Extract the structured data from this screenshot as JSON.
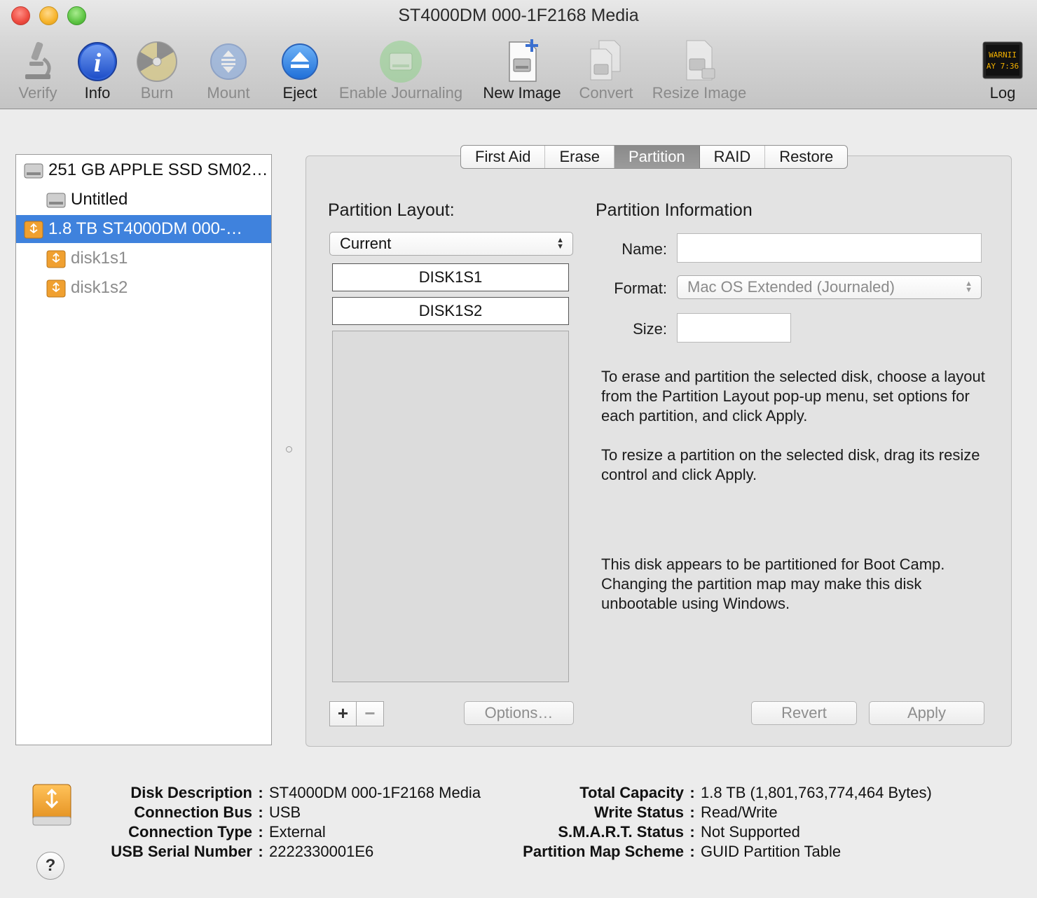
{
  "window": {
    "title": "ST4000DM 000-1F2168 Media"
  },
  "toolbar": {
    "items": [
      {
        "label": "Verify",
        "icon": "microscope-icon",
        "enabled": false
      },
      {
        "label": "Info",
        "icon": "info-icon",
        "enabled": true
      },
      {
        "label": "Burn",
        "icon": "burn-icon",
        "enabled": false
      },
      {
        "label": "Mount",
        "icon": "mount-icon",
        "enabled": false
      },
      {
        "label": "Eject",
        "icon": "eject-icon",
        "enabled": true
      },
      {
        "label": "Enable Journaling",
        "icon": "journaling-icon",
        "enabled": false
      },
      {
        "label": "New Image",
        "icon": "new-image-icon",
        "enabled": true
      },
      {
        "label": "Convert",
        "icon": "convert-icon",
        "enabled": false
      },
      {
        "label": "Resize Image",
        "icon": "resize-image-icon",
        "enabled": false
      },
      {
        "label": "Log",
        "icon": "log-icon",
        "enabled": true
      }
    ],
    "log_icon_text": [
      "WARNII",
      "AY 7:36"
    ]
  },
  "sidebar": {
    "items": [
      {
        "label": "251 GB APPLE SSD SM02…",
        "level": 0,
        "type": "internal-disk"
      },
      {
        "label": "Untitled",
        "level": 1,
        "type": "internal-volume"
      },
      {
        "label": "1.8 TB ST4000DM 000-…",
        "level": 0,
        "type": "usb-disk",
        "selected": true
      },
      {
        "label": "disk1s1",
        "level": 1,
        "type": "usb-volume",
        "dimmed": true
      },
      {
        "label": "disk1s2",
        "level": 1,
        "type": "usb-volume",
        "dimmed": true
      }
    ]
  },
  "tabs": {
    "items": [
      "First Aid",
      "Erase",
      "Partition",
      "RAID",
      "Restore"
    ],
    "active": "Partition"
  },
  "partition": {
    "layout_title": "Partition Layout:",
    "layout_value": "Current",
    "partitions": [
      "DISK1S1",
      "DISK1S2"
    ],
    "info_title": "Partition Information",
    "name_label": "Name:",
    "name_value": "",
    "format_label": "Format:",
    "format_value": "Mac OS Extended (Journaled)",
    "size_label": "Size:",
    "size_value": "",
    "help_text_1": "To erase and partition the selected disk, choose a layout from the Partition Layout pop-up menu, set options for each partition, and click Apply.",
    "help_text_2": "To resize a partition on the selected disk, drag its resize control and click Apply.",
    "help_text_3": "This disk appears to be partitioned for Boot Camp. Changing the partition map may make this disk unbootable using Windows.",
    "add_label": "+",
    "remove_label": "−",
    "options_label": "Options…",
    "revert_label": "Revert",
    "apply_label": "Apply"
  },
  "disk_info": {
    "left": [
      {
        "key": "Disk Description",
        "value": "ST4000DM 000-1F2168 Media"
      },
      {
        "key": "Connection Bus",
        "value": "USB"
      },
      {
        "key": "Connection Type",
        "value": "External"
      },
      {
        "key": "USB Serial Number",
        "value": "2222330001E6"
      }
    ],
    "right": [
      {
        "key": "Total Capacity",
        "value": "1.8 TB (1,801,763,774,464 Bytes)"
      },
      {
        "key": "Write Status",
        "value": "Read/Write"
      },
      {
        "key": "S.M.A.R.T. Status",
        "value": "Not Supported"
      },
      {
        "key": "Partition Map Scheme",
        "value": "GUID Partition Table"
      }
    ],
    "separator": ":",
    "help_label": "?"
  },
  "colors": {
    "selection": "#3f82dd",
    "info_blue": "#2c5fd6",
    "eject_blue": "#2f7fe0",
    "usb_orange": "#f0a030"
  }
}
